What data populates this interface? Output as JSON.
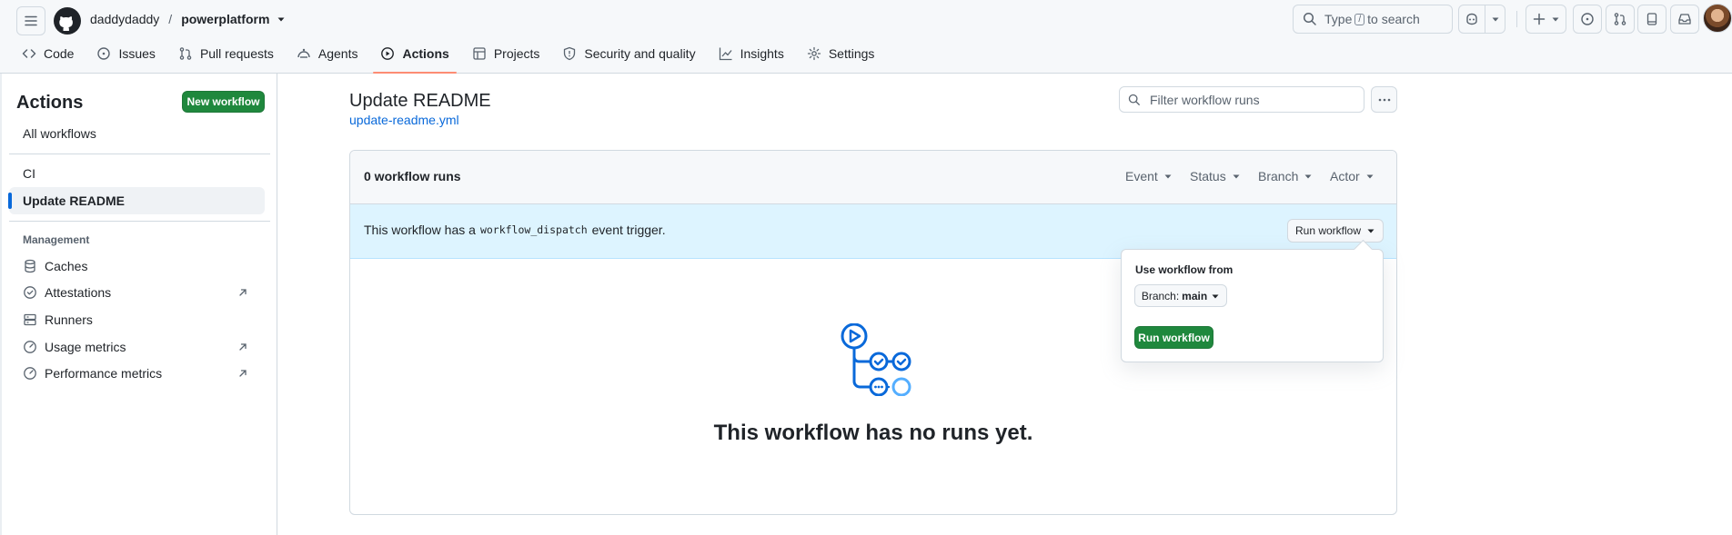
{
  "header": {
    "owner": "daddydaddy",
    "separator": "/",
    "repo": "powerplatform",
    "search_pre": "Type",
    "search_key": "/",
    "search_post": "to search"
  },
  "tabs": [
    {
      "label": "Code",
      "icon": "code-icon"
    },
    {
      "label": "Issues",
      "icon": "issue-opened-icon"
    },
    {
      "label": "Pull requests",
      "icon": "git-pull-request-icon"
    },
    {
      "label": "Agents",
      "icon": "agents-icon"
    },
    {
      "label": "Actions",
      "icon": "play-icon",
      "selected": true
    },
    {
      "label": "Projects",
      "icon": "table-icon"
    },
    {
      "label": "Security and quality",
      "icon": "shield-icon"
    },
    {
      "label": "Insights",
      "icon": "graph-icon"
    },
    {
      "label": "Settings",
      "icon": "gear-icon"
    }
  ],
  "sidebar": {
    "title": "Actions",
    "new_workflow": "New workflow",
    "all_workflows": "All workflows",
    "workflows": [
      "CI",
      "Update README"
    ],
    "management_heading": "Management",
    "management": [
      {
        "label": "Caches",
        "icon": "database-icon"
      },
      {
        "label": "Attestations",
        "icon": "verified-icon"
      },
      {
        "label": "Runners",
        "icon": "server-icon"
      },
      {
        "label": "Usage metrics",
        "icon": "meter-icon"
      },
      {
        "label": "Performance metrics",
        "icon": "meter-icon"
      }
    ]
  },
  "main": {
    "title": "Update README",
    "file": "update-readme.yml",
    "filter_placeholder": "Filter workflow runs",
    "runs_count": "0 workflow runs",
    "filters": [
      "Event",
      "Status",
      "Branch",
      "Actor"
    ],
    "trigger_pre": "This workflow has a",
    "trigger_code": "workflow_dispatch",
    "trigger_post": "event trigger.",
    "run_workflow_dropdown": "Run workflow",
    "empty_title": "This workflow has no runs yet."
  },
  "popover": {
    "label": "Use workflow from",
    "branch_prefix": "Branch:",
    "branch": "main",
    "run_button": "Run workflow"
  },
  "colors": {
    "accent": "#0969da",
    "primary_button": "#1f883d",
    "selected_tab_underline": "#fd8c73",
    "trigger_banner": "#ddf4ff"
  }
}
